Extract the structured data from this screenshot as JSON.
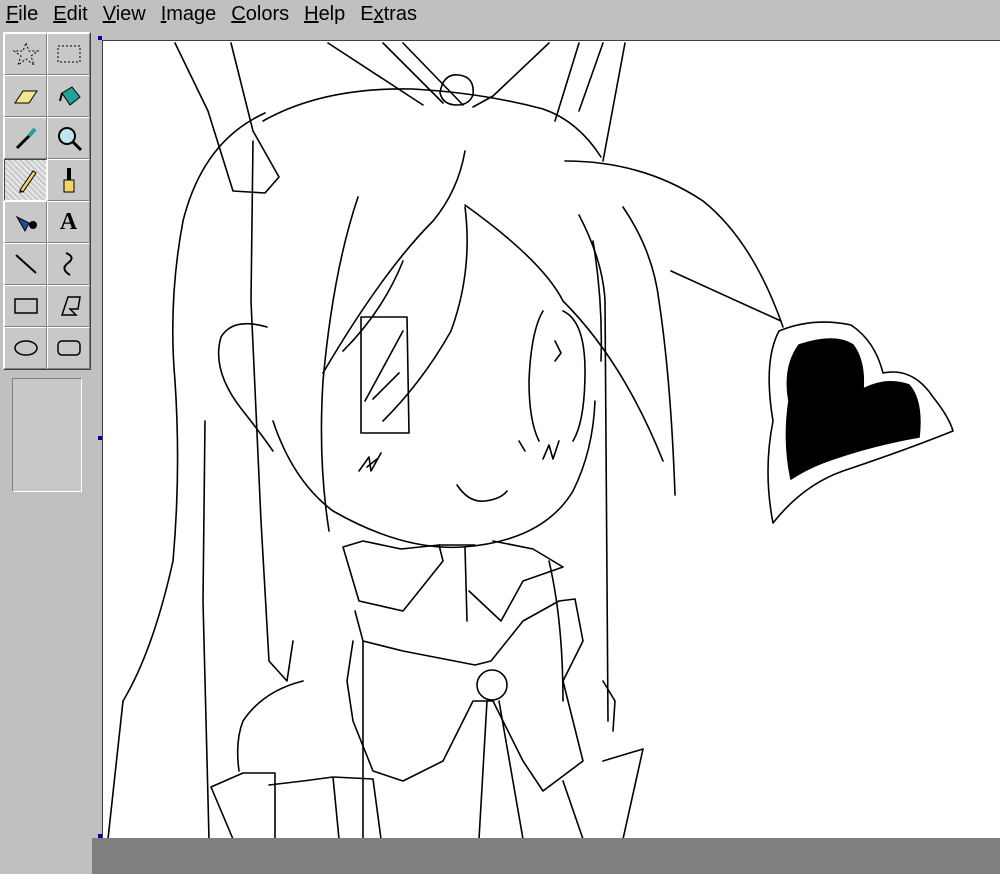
{
  "menubar": {
    "items": [
      {
        "label": "File",
        "accel": "F",
        "rest": "ile"
      },
      {
        "label": "Edit",
        "accel": "E",
        "rest": "dit"
      },
      {
        "label": "View",
        "accel": "V",
        "rest": "iew"
      },
      {
        "label": "Image",
        "accel": "I",
        "rest": "mage"
      },
      {
        "label": "Colors",
        "accel": "C",
        "rest": "olors"
      },
      {
        "label": "Help",
        "accel": "H",
        "rest": "elp"
      },
      {
        "label": "Extras",
        "pre": "E",
        "accel": "x",
        "rest": "tras"
      }
    ]
  },
  "tools": [
    {
      "name": "free-form-select",
      "icon": "star-select-icon"
    },
    {
      "name": "rectangle-select",
      "icon": "rect-select-icon"
    },
    {
      "name": "eraser",
      "icon": "eraser-icon"
    },
    {
      "name": "fill",
      "icon": "paint-bucket-icon"
    },
    {
      "name": "pick-color",
      "icon": "eyedropper-icon"
    },
    {
      "name": "magnifier",
      "icon": "magnifier-icon"
    },
    {
      "name": "pencil",
      "icon": "pencil-icon",
      "active": true
    },
    {
      "name": "brush",
      "icon": "brush-icon"
    },
    {
      "name": "airbrush",
      "icon": "airbrush-icon"
    },
    {
      "name": "text",
      "icon": "text-icon",
      "glyph": "A"
    },
    {
      "name": "line",
      "icon": "line-icon"
    },
    {
      "name": "curve",
      "icon": "curve-icon"
    },
    {
      "name": "rectangle",
      "icon": "rectangle-icon"
    },
    {
      "name": "polygon",
      "icon": "polygon-icon"
    },
    {
      "name": "ellipse",
      "icon": "ellipse-icon"
    },
    {
      "name": "rounded-rectangle",
      "icon": "rounded-rect-icon"
    }
  ],
  "colors": {
    "face": "#c0c0c0",
    "canvas": "#ffffff",
    "ink": "#000000",
    "workspace_dark": "#7f7f7f",
    "handle": "#0000a8"
  }
}
